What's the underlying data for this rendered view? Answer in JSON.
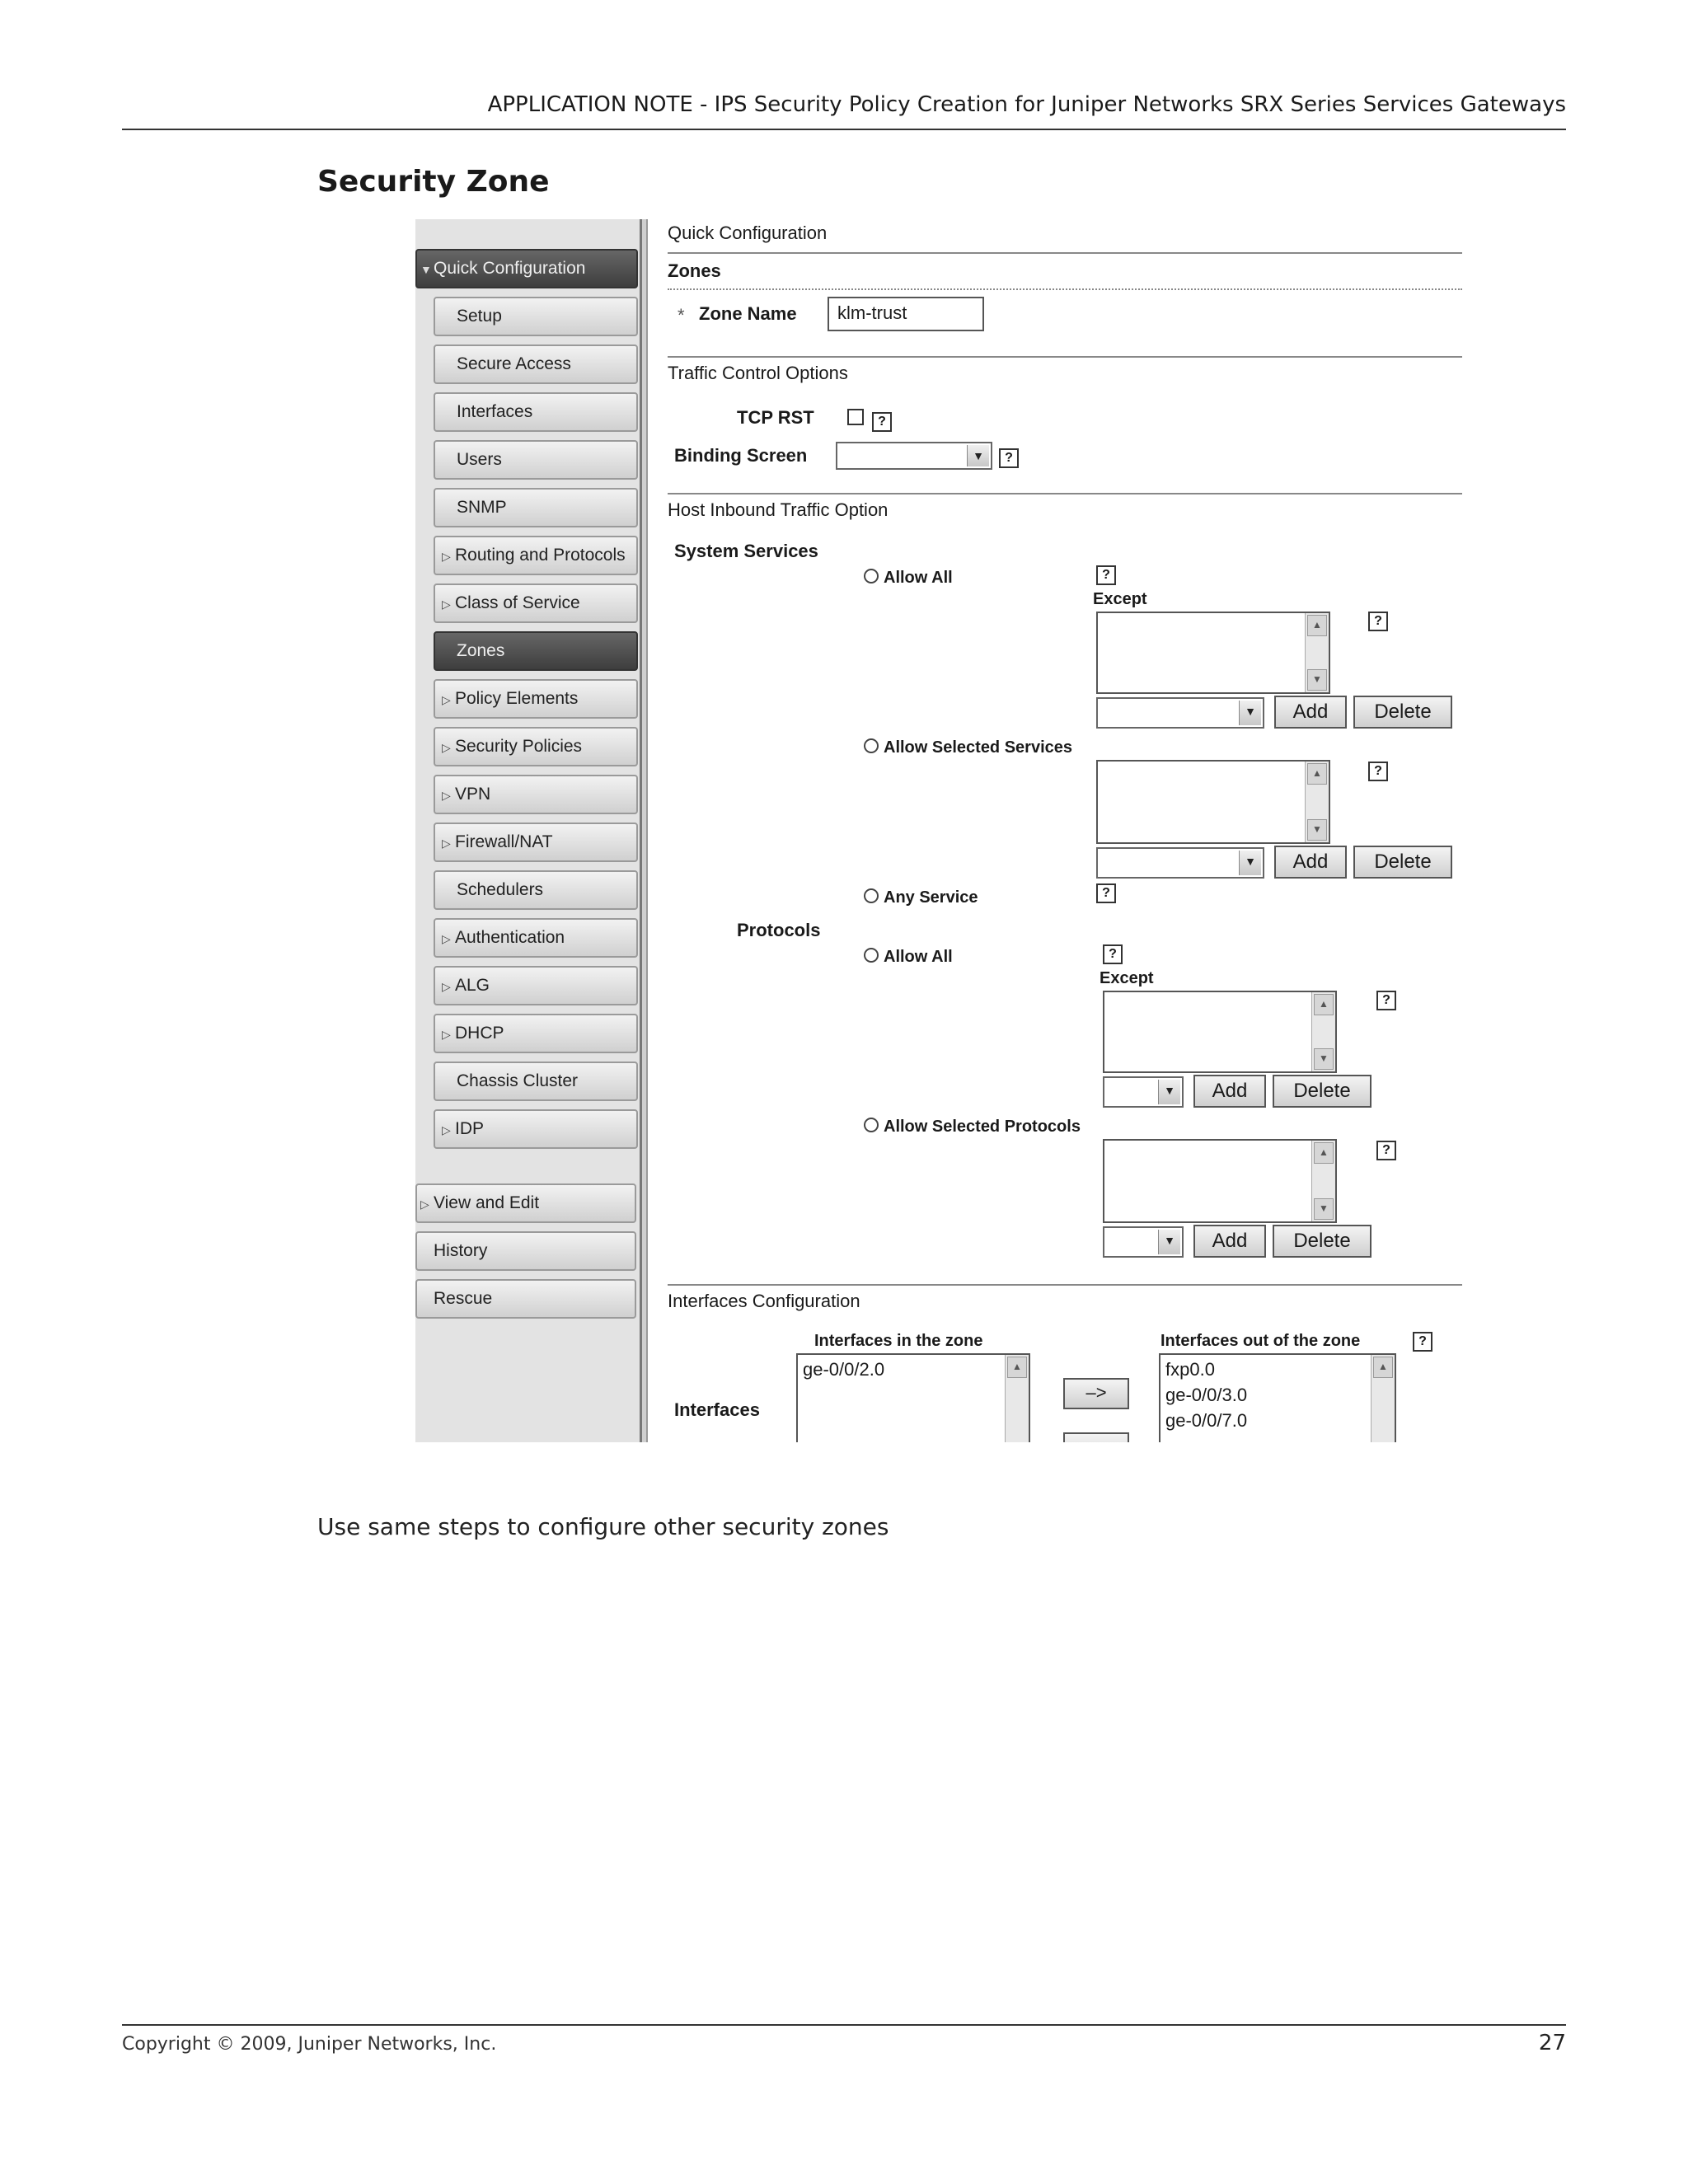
{
  "header": {
    "title": "APPLICATION NOTE - IPS Security Policy Creation for Juniper Networks SRX Series Services Gateways"
  },
  "section_title": "Security Zone",
  "nav": {
    "items": [
      {
        "label": "Quick Configuration",
        "arrow": "▼",
        "state": "expanded-dark"
      },
      {
        "label": "Setup"
      },
      {
        "label": "Secure Access"
      },
      {
        "label": "Interfaces"
      },
      {
        "label": "Users"
      },
      {
        "label": "SNMP"
      },
      {
        "label": "Routing and Protocols",
        "arrow": "▷"
      },
      {
        "label": "Class of Service",
        "arrow": "▷"
      },
      {
        "label": "Zones",
        "state": "selected-dark"
      },
      {
        "label": "Policy Elements",
        "arrow": "▷"
      },
      {
        "label": "Security Policies",
        "arrow": "▷"
      },
      {
        "label": "VPN",
        "arrow": "▷"
      },
      {
        "label": "Firewall/NAT",
        "arrow": "▷"
      },
      {
        "label": "Schedulers"
      },
      {
        "label": "Authentication",
        "arrow": "▷"
      },
      {
        "label": "ALG",
        "arrow": "▷"
      },
      {
        "label": "DHCP",
        "arrow": "▷"
      },
      {
        "label": "Chassis Cluster"
      },
      {
        "label": "IDP",
        "arrow": "▷"
      },
      {
        "label": "View and Edit",
        "arrow": "▷"
      },
      {
        "label": "History"
      },
      {
        "label": "Rescue"
      }
    ]
  },
  "form": {
    "breadcrumb": "Quick Configuration",
    "heading": "Zones",
    "required_mark": "*",
    "zone_name_label": "Zone Name",
    "zone_name_value": "klm-trust",
    "traffic_section": "Traffic Control Options",
    "tcp_rst_label": "TCP RST",
    "binding_screen_label": "Binding Screen",
    "host_inbound_section": "Host Inbound Traffic Option",
    "system_services_label": "System Services",
    "protocols_label": "Protocols",
    "allow_all": "Allow All",
    "except": "Except",
    "allow_selected_services": "Allow Selected Services",
    "any_service": "Any Service",
    "allow_selected_protocols": "Allow Selected Protocols",
    "add": "Add",
    "delete": "Delete",
    "help": "?",
    "interfaces_section": "Interfaces Configuration",
    "interfaces_label": "Interfaces",
    "in_zone_label": "Interfaces in the zone",
    "out_zone_label": "Interfaces out of the zone",
    "in_zone_items": [
      "ge-0/0/2.0"
    ],
    "out_zone_items": [
      "fxp0.0",
      "ge-0/0/3.0",
      "ge-0/0/7.0"
    ],
    "move_arrow": "–>"
  },
  "body_text": "Use same steps to configure other security zones",
  "footer": {
    "copyright": "Copyright © 2009, Juniper Networks, Inc.",
    "page": "27"
  }
}
